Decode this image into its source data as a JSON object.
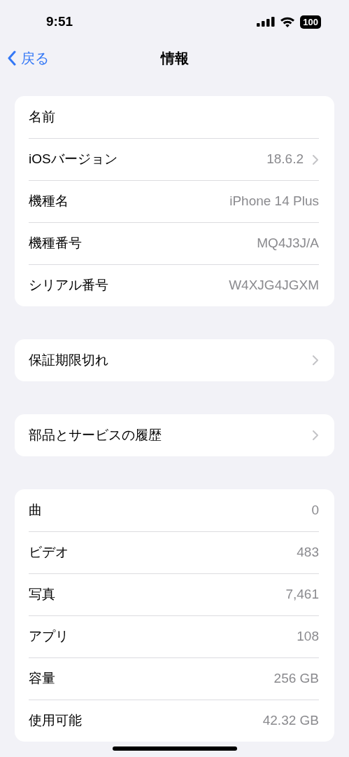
{
  "status_bar": {
    "time": "9:51",
    "battery": "100"
  },
  "nav": {
    "back": "戻る",
    "title": "情報"
  },
  "groups": [
    {
      "rows": [
        {
          "label": "名前",
          "chevron": false
        },
        {
          "label": "iOSバージョン",
          "value": "18.6.2",
          "chevron": true
        },
        {
          "label": "機種名",
          "value": "iPhone 14 Plus",
          "chevron": false
        },
        {
          "label": "機種番号",
          "value": "MQ4J3J/A",
          "chevron": false
        },
        {
          "label": "シリアル番号",
          "value": "W4XJG4JGXM",
          "chevron": false
        }
      ]
    },
    {
      "rows": [
        {
          "label": "保証期限切れ",
          "chevron": true
        }
      ]
    },
    {
      "rows": [
        {
          "label": "部品とサービスの履歴",
          "chevron": true
        }
      ]
    },
    {
      "rows": [
        {
          "label": "曲",
          "value": "0",
          "chevron": false
        },
        {
          "label": "ビデオ",
          "value": "483",
          "chevron": false
        },
        {
          "label": "写真",
          "value": "7,461",
          "chevron": false
        },
        {
          "label": "アプリ",
          "value": "108",
          "chevron": false
        },
        {
          "label": "容量",
          "value": "256 GB",
          "chevron": false
        },
        {
          "label": "使用可能",
          "value": "42.32 GB",
          "chevron": false
        }
      ]
    }
  ]
}
